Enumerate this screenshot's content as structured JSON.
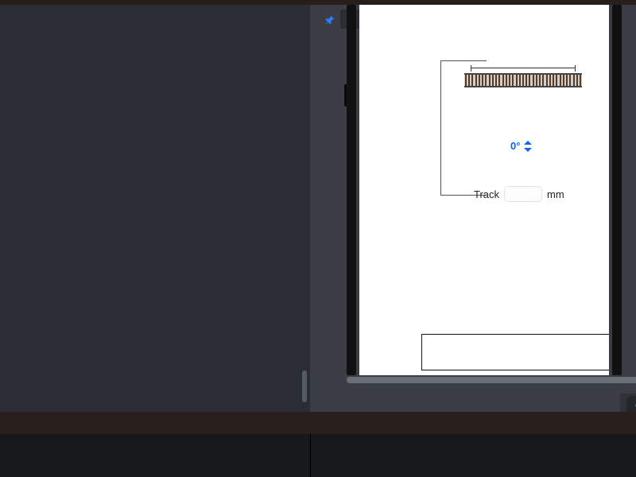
{
  "pin": {
    "tooltip": "Pin"
  },
  "canvas": {
    "angle_label": "0°",
    "track_label": "Track",
    "track_unit": "mm",
    "track_value": ""
  },
  "toolbar": {
    "group1": [
      "record",
      "bounds",
      "grid"
    ],
    "group2": [
      "settings-toggle",
      "orientation"
    ],
    "zoom": [
      "zoom-out",
      "zoom-reset",
      "zoom-in"
    ]
  }
}
